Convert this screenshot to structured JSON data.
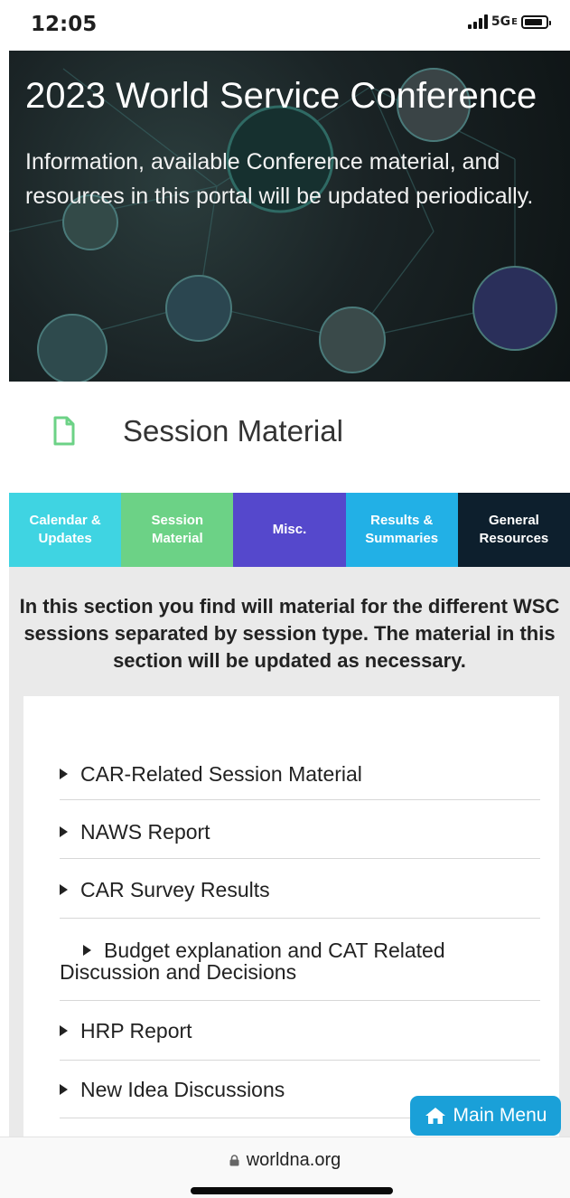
{
  "status_bar": {
    "time": "12:05",
    "network": "5G",
    "network_suffix": "E"
  },
  "hero": {
    "title": "2023 World Service Conference",
    "description": "Information, available Conference material, and resources in this portal will be updated periodically."
  },
  "section": {
    "icon": "document-icon",
    "title": "Session Material"
  },
  "tabs": [
    {
      "label": "Calendar & Updates",
      "color": "#3fd4e2"
    },
    {
      "label": "Session Material",
      "color": "#6cd286"
    },
    {
      "label": "Misc.",
      "color": "#5548cc"
    },
    {
      "label": "Results & Summaries",
      "color": "#22b0e6"
    },
    {
      "label": "General Resources",
      "color": "#0d1f2d"
    }
  ],
  "intro": "In this section you find will material for the different WSC sessions separated by session type. The material in this section will be updated as necessary.",
  "list_items": [
    "CAR-Related Session Material",
    "NAWS Report",
    "CAR Survey Results",
    "Budget explanation and CAT Related Discussion and Decisions",
    "HRP Report",
    "New Idea Discussions"
  ],
  "main_menu": {
    "label": "Main Menu",
    "icon": "home-icon",
    "color": "#1aa0d8"
  },
  "browser": {
    "url": "worldna.org"
  }
}
